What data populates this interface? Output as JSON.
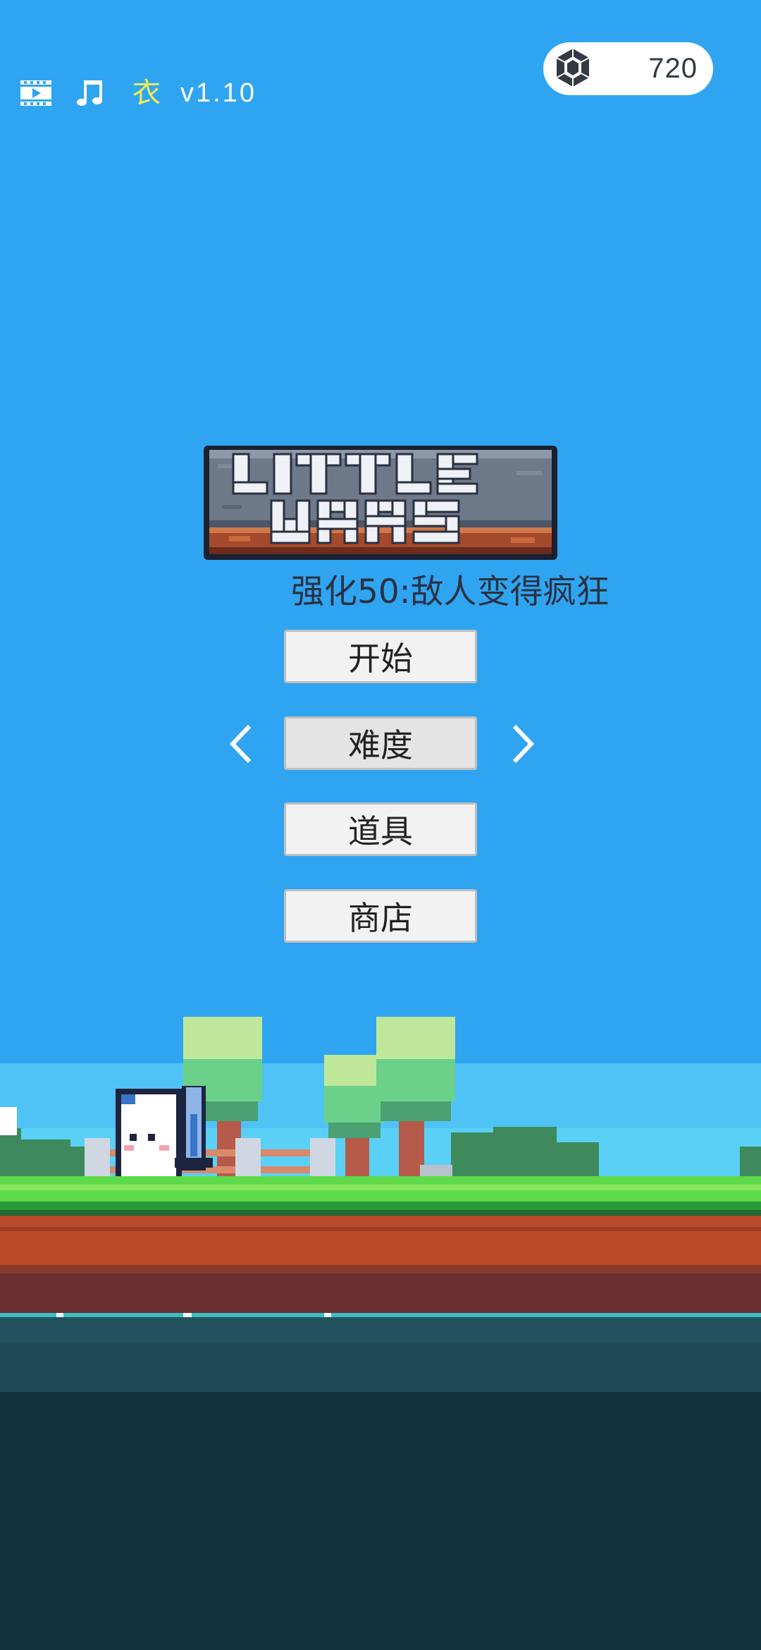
{
  "topbar": {
    "icons": [
      "video-icon",
      "music-note-icon"
    ],
    "tag_char": "衣",
    "version": "v1.10"
  },
  "currency": {
    "icon": "gem-icon",
    "amount": "720"
  },
  "logo": {
    "line1": "LITTLE",
    "line2": "WARS"
  },
  "subtitle": "强化50:敌人变得疯狂",
  "menu": {
    "start": "开始",
    "difficulty": "难度",
    "items": "道具",
    "shop": "商店"
  },
  "colors": {
    "sky": "#2fa5f2",
    "grass": "#5ed94a",
    "dirt": "#b84a2a",
    "water": "#1d4a55",
    "deep": "#12333f"
  }
}
